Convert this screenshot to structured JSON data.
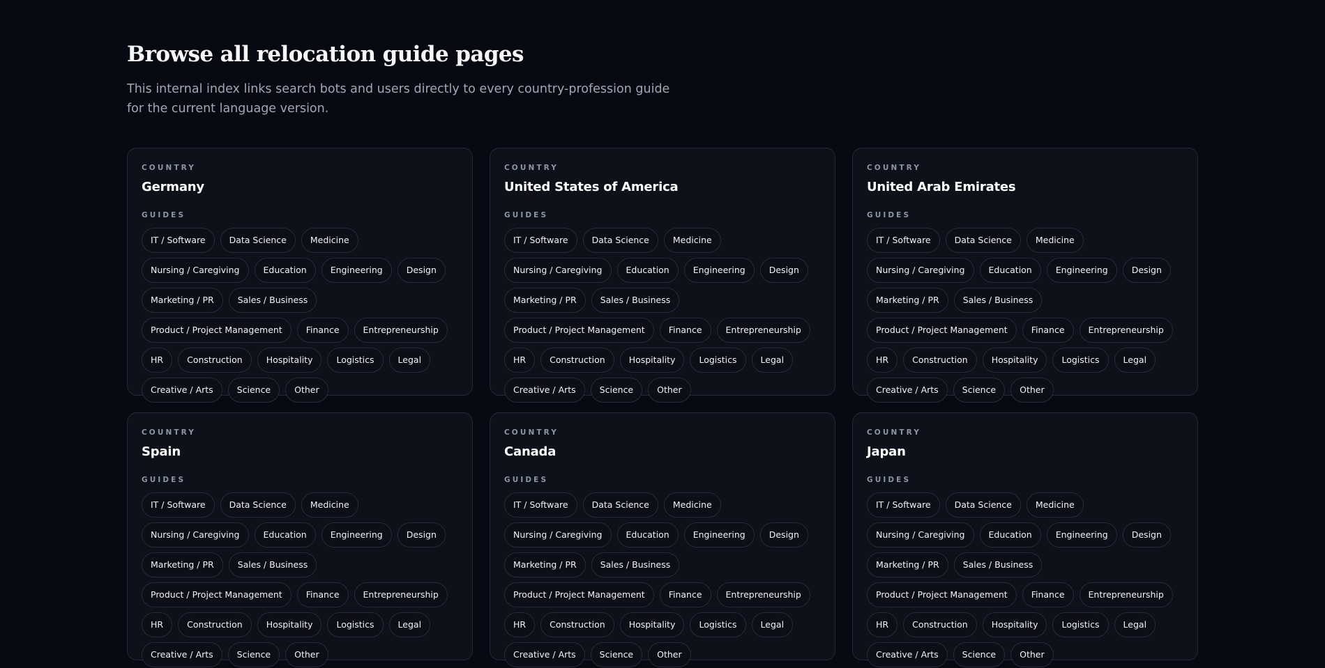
{
  "header": {
    "title": "Browse all relocation guide pages",
    "subtitle": "This internal index links search bots and users directly to every country-profession guide for the current language version."
  },
  "labels": {
    "country": "COUNTRY",
    "guides": "GUIDES"
  },
  "countries": [
    {
      "name": "Germany",
      "guides": [
        "IT / Software",
        "Data Science",
        "Medicine",
        "Nursing / Caregiving",
        "Education",
        "Engineering",
        "Design",
        "Marketing / PR",
        "Sales / Business",
        "Product / Project Management",
        "Finance",
        "Entrepreneurship",
        "HR",
        "Construction",
        "Hospitality",
        "Logistics",
        "Legal",
        "Creative / Arts",
        "Science",
        "Other"
      ]
    },
    {
      "name": "United States of America",
      "guides": [
        "IT / Software",
        "Data Science",
        "Medicine",
        "Nursing / Caregiving",
        "Education",
        "Engineering",
        "Design",
        "Marketing / PR",
        "Sales / Business",
        "Product / Project Management",
        "Finance",
        "Entrepreneurship",
        "HR",
        "Construction",
        "Hospitality",
        "Logistics",
        "Legal",
        "Creative / Arts",
        "Science",
        "Other"
      ]
    },
    {
      "name": "United Arab Emirates",
      "guides": [
        "IT / Software",
        "Data Science",
        "Medicine",
        "Nursing / Caregiving",
        "Education",
        "Engineering",
        "Design",
        "Marketing / PR",
        "Sales / Business",
        "Product / Project Management",
        "Finance",
        "Entrepreneurship",
        "HR",
        "Construction",
        "Hospitality",
        "Logistics",
        "Legal",
        "Creative / Arts",
        "Science",
        "Other"
      ]
    },
    {
      "name": "Spain",
      "guides": [
        "IT / Software",
        "Data Science",
        "Medicine",
        "Nursing / Caregiving",
        "Education",
        "Engineering",
        "Design",
        "Marketing / PR",
        "Sales / Business",
        "Product / Project Management",
        "Finance",
        "Entrepreneurship",
        "HR",
        "Construction",
        "Hospitality",
        "Logistics",
        "Legal",
        "Creative / Arts",
        "Science",
        "Other"
      ]
    },
    {
      "name": "Canada",
      "guides": [
        "IT / Software",
        "Data Science",
        "Medicine",
        "Nursing / Caregiving",
        "Education",
        "Engineering",
        "Design",
        "Marketing / PR",
        "Sales / Business",
        "Product / Project Management",
        "Finance",
        "Entrepreneurship",
        "HR",
        "Construction",
        "Hospitality",
        "Logistics",
        "Legal",
        "Creative / Arts",
        "Science",
        "Other"
      ]
    },
    {
      "name": "Japan",
      "guides": [
        "IT / Software",
        "Data Science",
        "Medicine",
        "Nursing / Caregiving",
        "Education",
        "Engineering",
        "Design",
        "Marketing / PR",
        "Sales / Business",
        "Product / Project Management",
        "Finance",
        "Entrepreneurship",
        "HR",
        "Construction",
        "Hospitality",
        "Logistics",
        "Legal",
        "Creative / Arts",
        "Science",
        "Other"
      ]
    }
  ],
  "colors": {
    "background": "#070a12",
    "card": "#0d111a",
    "border": "#242938",
    "text": "#f4f4f6",
    "muted": "#a4a7b3"
  }
}
